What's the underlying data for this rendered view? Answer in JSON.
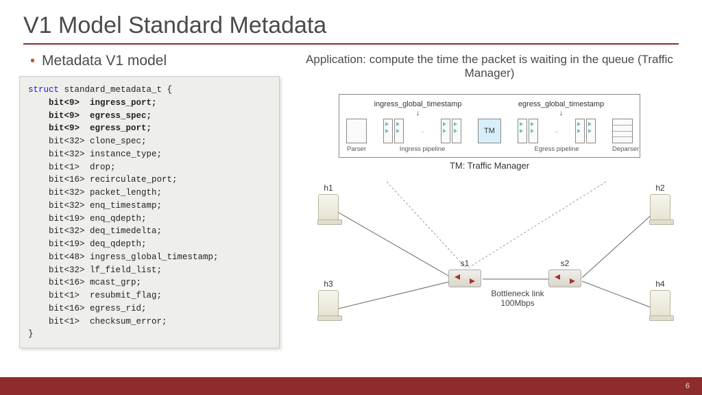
{
  "title": "V1 Model Standard Metadata",
  "bullet": "Metadata V1 model",
  "code": {
    "struct_kw": "struct",
    "struct_name": "standard_metadata_t {",
    "fields": [
      {
        "type": "bit<9>",
        "name": "ingress_port;",
        "bold": true
      },
      {
        "type": "bit<9>",
        "name": "egress_spec;",
        "bold": true
      },
      {
        "type": "bit<9>",
        "name": "egress_port;",
        "bold": true
      },
      {
        "type": "bit<32>",
        "name": "clone_spec;",
        "bold": false
      },
      {
        "type": "bit<32>",
        "name": "instance_type;",
        "bold": false
      },
      {
        "type": "bit<1>",
        "name": "drop;",
        "bold": false
      },
      {
        "type": "bit<16>",
        "name": "recirculate_port;",
        "bold": false
      },
      {
        "type": "bit<32>",
        "name": "packet_length;",
        "bold": false
      },
      {
        "type": "bit<32>",
        "name": "enq_timestamp;",
        "bold": false
      },
      {
        "type": "bit<19>",
        "name": "enq_qdepth;",
        "bold": false
      },
      {
        "type": "bit<32>",
        "name": "deq_timedelta;",
        "bold": false
      },
      {
        "type": "bit<19>",
        "name": "deq_qdepth;",
        "bold": false
      },
      {
        "type": "bit<48>",
        "name": "ingress_global_timestamp;",
        "bold": false
      },
      {
        "type": "bit<32>",
        "name": "lf_field_list;",
        "bold": false
      },
      {
        "type": "bit<16>",
        "name": "mcast_grp;",
        "bold": false
      },
      {
        "type": "bit<1>",
        "name": "resubmit_flag;",
        "bold": false
      },
      {
        "type": "bit<16>",
        "name": "egress_rid;",
        "bold": false
      },
      {
        "type": "bit<1>",
        "name": "checksum_error;",
        "bold": false
      }
    ],
    "close": "}"
  },
  "application_text": "Application: compute the time the packet is waiting in the queue (Traffic Manager)",
  "pipeline": {
    "ts1": "ingress_global_timestamp",
    "ts2": "egress_global_timestamp",
    "parser": "Parser",
    "ingress": "Ingress pipeline",
    "tm": "TM",
    "egress": "Egress pipeline",
    "deparser": "Deparser",
    "caption": "TM: Traffic Manager"
  },
  "topology": {
    "hosts": [
      "h1",
      "h2",
      "h3",
      "h4"
    ],
    "switches": [
      "s1",
      "s2"
    ],
    "link_label_1": "Bottleneck link",
    "link_label_2": "100Mbps"
  },
  "page_number": "6"
}
